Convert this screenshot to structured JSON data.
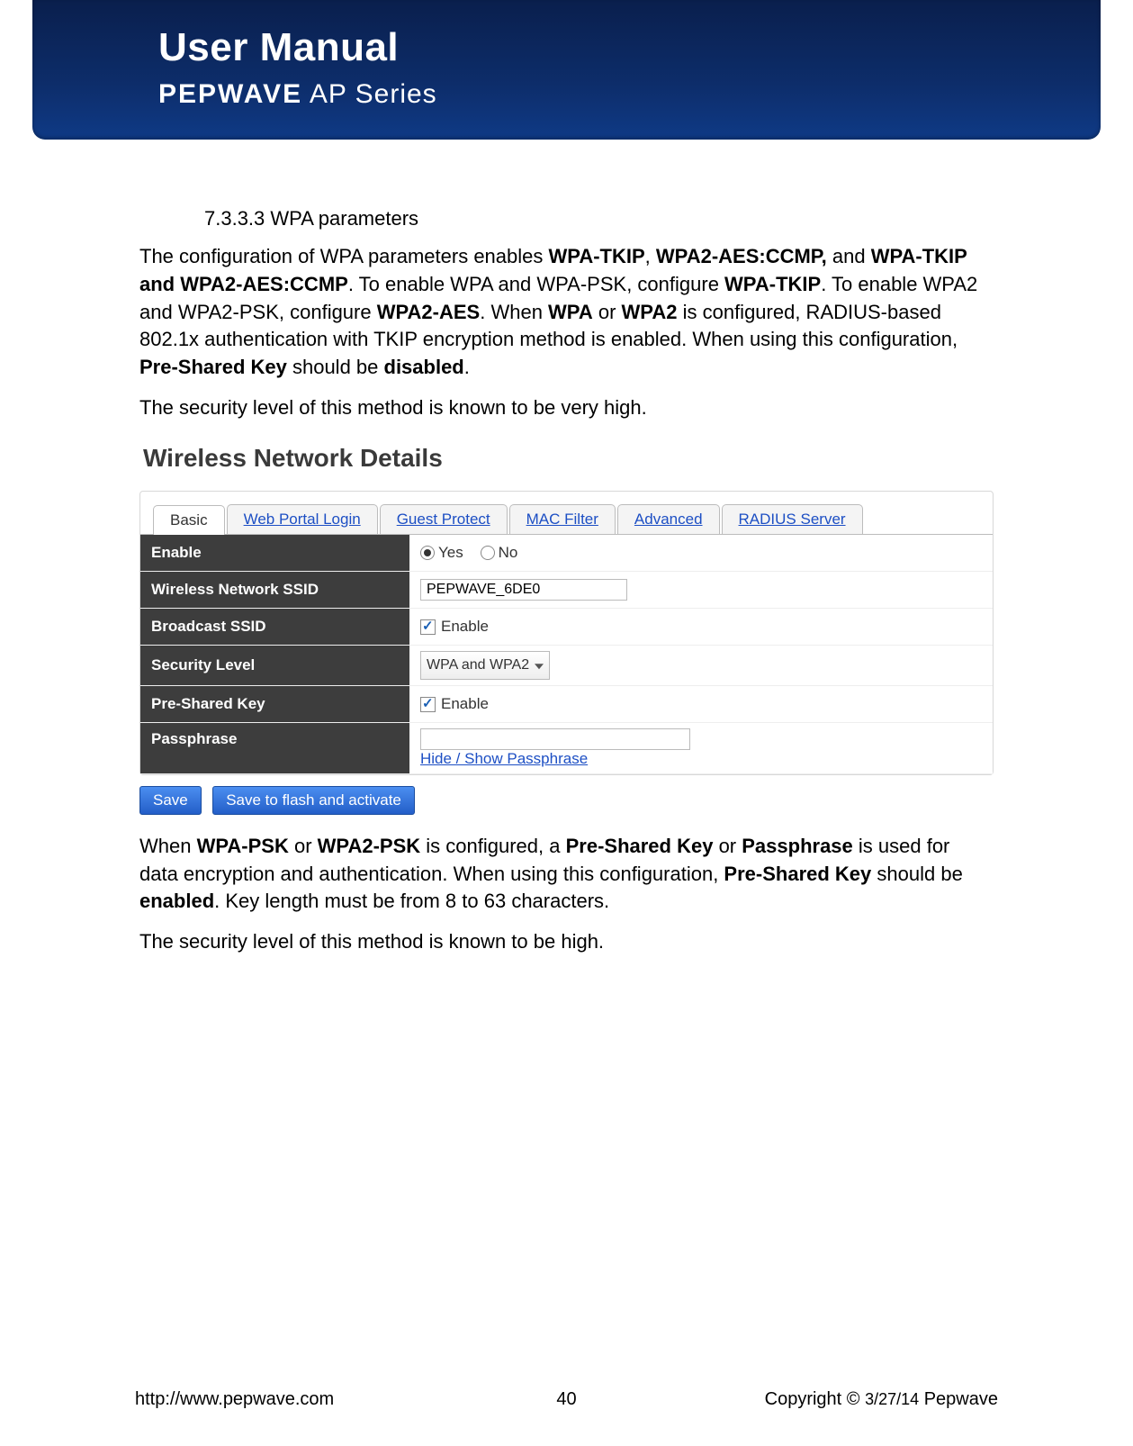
{
  "header": {
    "title": "User Manual",
    "brand_bold": "PEPWAVE",
    "brand_light": " AP Series"
  },
  "section": {
    "number": "7.3.3.3 WPA parameters",
    "p1_pre": "The configuration of WPA parameters enables ",
    "p1_b1": "WPA-TKIP",
    "p1_c1": ", ",
    "p1_b2": "WPA2-AES:CCMP,",
    "p1_c2": " and ",
    "p1_b3": "WPA-TKIP and WPA2-AES:CCMP",
    "p1_c3": ". To enable WPA and WPA-PSK, configure ",
    "p1_b4": "WPA-TKIP",
    "p1_c4": ". To enable WPA2 and WPA2-PSK, configure ",
    "p1_b5": "WPA2-AES",
    "p1_c5": ". When ",
    "p1_b6": "WPA",
    "p1_c6": " or ",
    "p1_b7": "WPA2",
    "p1_c7": " is configured, RADIUS-based 802.1x authentication with TKIP encryption method is enabled. When using this configuration, ",
    "p1_b8": "Pre-Shared Key",
    "p1_c8": " should be ",
    "p1_b9": "disabled",
    "p1_c9": ".",
    "p2": "The security level of this method is known to be very high.",
    "p3_pre": "When ",
    "p3_b1": "WPA-PSK",
    "p3_c1": " or ",
    "p3_b2": "WPA2-PSK",
    "p3_c2": " is configured, a ",
    "p3_b3": "Pre-Shared Key",
    "p3_c3": " or ",
    "p3_b4": "Passphrase",
    "p3_c4": " is used for data encryption and authentication. When using this configuration, ",
    "p3_b5": "Pre-Shared Key",
    "p3_c5": " should be ",
    "p3_b6": "enabled",
    "p3_c6": ". Key length must be from 8 to 63 characters.",
    "p4": "The security level of this method is known to be high."
  },
  "ui": {
    "title": "Wireless Network Details",
    "tabs": {
      "basic": "Basic",
      "web": "Web Portal Login",
      "guest": "Guest Protect",
      "mac": "MAC Filter",
      "adv": "Advanced",
      "radius": "RADIUS Server"
    },
    "rows": {
      "enable_label": "Enable",
      "enable_yes": "Yes",
      "enable_no": "No",
      "ssid_label": "Wireless Network SSID",
      "ssid_value": "PEPWAVE_6DE0",
      "broadcast_label": "Broadcast SSID",
      "broadcast_value": "Enable",
      "security_label": "Security Level",
      "security_value": "WPA and WPA2",
      "psk_label": "Pre-Shared Key",
      "psk_value": "Enable",
      "passphrase_label": "Passphrase",
      "passphrase_link": "Hide / Show Passphrase"
    },
    "buttons": {
      "save": "Save",
      "save_flash": "Save to flash and activate"
    }
  },
  "footer": {
    "url": "http://www.pepwave.com",
    "page": "40",
    "copyright_pre": "Copyright © ",
    "copyright_date": "3/27/14",
    "copyright_post": " Pepwave"
  }
}
